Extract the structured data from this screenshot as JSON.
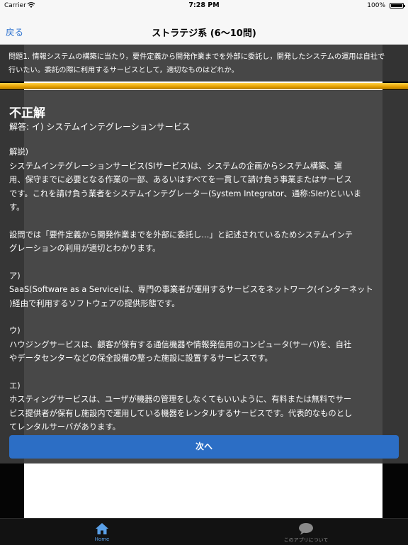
{
  "status_bar": {
    "carrier": "Carrier",
    "time": "7:28 PM",
    "battery": "100%"
  },
  "nav": {
    "back_label": "戻る",
    "title": "ストラテジ系 (6〜10問)"
  },
  "question": {
    "lines": [
      "問題1. 情報システムの構築に当たり，要件定義から開発作業までを外部に委託し，開発したシステムの運用は自社で",
      "行いたい。委託の際に利用するサービスとして，適切なものはどれか。"
    ]
  },
  "progress": {
    "fraction": 1.0
  },
  "answer": {
    "result": "不正解",
    "answer_line": "解答: イ) システムインテグレーションサービス",
    "explanation": [
      "解説)\nシステムインテグレーションサービス(SIサービス)は、システムの企画からシステム構築、運\n用、保守までに必要となる作業の一部、あるいはすべてを一貫して請け負う事業またはサービス\nです。これを請け負う業者をシステムインテグレーター(System Integrator、通称:SIer)といいま\nす。",
      "設問では「要件定義から開発作業までを外部に委託し…」と記述されているためシステムインテ\nグレーションの利用が適切とわかります。",
      "ア)\nSaaS(Software as a Service)は、専門の事業者が運用するサービスをネットワーク(インターネット\n)経由で利用するソフトウェアの提供形態です。",
      "ウ)\nハウジングサービスは、顧客が保有する通信機器や情報発信用のコンピュータ(サーバ)を、自社\nやデータセンターなどの保全設備の整った施設に設置するサービスです。",
      "エ)\nホスティングサービスは、ユーザが機器の管理をしなくてもいいように、有料または無料でサー\nビス提供者が保有し施設内で運用している機器をレンタルするサービスです。代表的なものとし\nてレンタルサーバがあります。"
    ]
  },
  "next_button": {
    "label": "次へ"
  },
  "tabs": [
    {
      "label": "Home",
      "icon": "home-icon",
      "active": true
    },
    {
      "label": "このアプリについて",
      "icon": "chat-bubble-icon",
      "active": false
    }
  ],
  "colors": {
    "accent": "#2c6ec5",
    "progress": "#e8a200",
    "tab_active": "#5aa0e8"
  }
}
